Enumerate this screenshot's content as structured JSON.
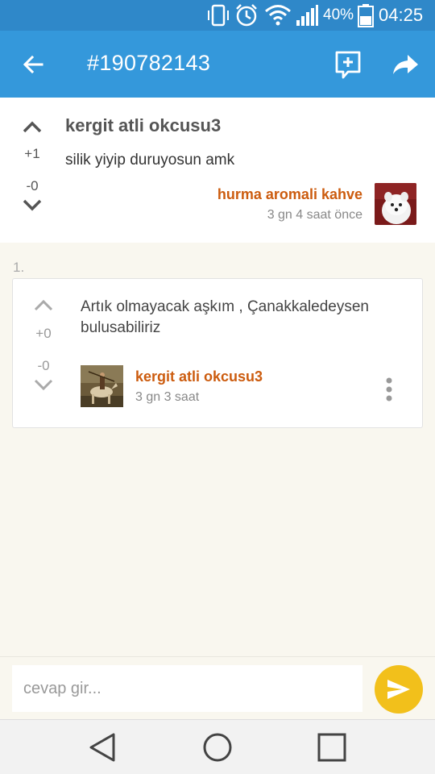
{
  "status_bar": {
    "battery": "40%",
    "time": "04:25"
  },
  "app_bar": {
    "title": "#190782143",
    "icons": [
      "back-arrow-icon",
      "add-comment-icon",
      "share-icon"
    ]
  },
  "post": {
    "author": "kergit atli okcusu3",
    "text": "silik yiyip duruyosun amk",
    "upvotes": "+1",
    "downvotes": "-0",
    "op_name": "hurma aromali kahve",
    "op_time": "3 gn 4 saat  önce"
  },
  "replies": [
    {
      "index": "1.",
      "text": "Artık olmayacak aşkım , Çanakkaledeysen bulusabiliriz",
      "upvotes": "+0",
      "downvotes": "-0",
      "author": "kergit atli okcusu3",
      "time": "3 gn 3 saat"
    }
  ],
  "composer": {
    "placeholder": "cevap gir..."
  },
  "colors": {
    "status_bar": "#2f88c9",
    "app_bar": "#3498db",
    "username": "#cc5c0f",
    "send_button": "#f2c01b",
    "background": "#f9f7ef"
  }
}
